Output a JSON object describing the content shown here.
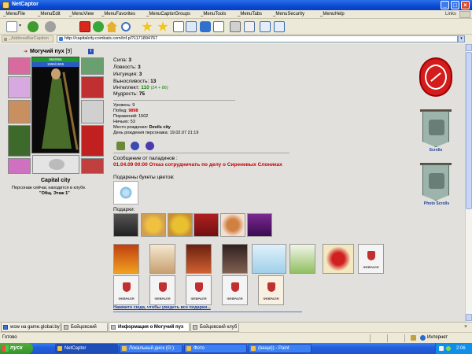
{
  "window": {
    "title": "NetCaptor"
  },
  "menu": {
    "items": [
      "_MenuFile",
      "_MenuEdit",
      "_MenuView",
      "_MenuFavorites",
      "_MenuCaptorGroups",
      "_MenuTools",
      "_MenuTabs",
      "_MenuSecurity",
      "_MenuHelp"
    ],
    "links": "Links"
  },
  "address": {
    "caption": "_AddressBarCaption",
    "url": "http://capitalcity.combats.com/inf.pl?1171894767"
  },
  "character": {
    "name": "Могучий пух",
    "level": "[9]",
    "info_badge": "i",
    "hp": "966/966",
    "mana": "1555/1555",
    "city": "Capital city",
    "location_text": "Персонаж сейчас находится в клубе.",
    "location_place": "\"Общ. Этаж 1\""
  },
  "stats": [
    {
      "label": "Сила:",
      "value": "3"
    },
    {
      "label": "Ловкость:",
      "value": "3"
    },
    {
      "label": "Интуиция:",
      "value": "3"
    },
    {
      "label": "Выносливость:",
      "value": "13"
    },
    {
      "label": "Интеллект:",
      "value": "110",
      "extra": "(24 + 86)"
    },
    {
      "label": "Мудрость:",
      "value": "75"
    }
  ],
  "record": [
    {
      "label": "Уровень:",
      "value": "9"
    },
    {
      "label": "Побед:",
      "value": "9898"
    },
    {
      "label": "Поражений:",
      "value": "1502"
    },
    {
      "label": "Ничьих:",
      "value": "53"
    },
    {
      "label": "Место рождения:",
      "value": "Devils city"
    },
    {
      "label": "День рождения персонажа:",
      "value": "19.02.07 21:19"
    }
  ],
  "paladins": {
    "heading": "Сообщение от паладинов :",
    "message": "01.04.09 00:00 Отказ сотрудничать по делу о Сиреневых Слониках"
  },
  "flowers_heading": "Подарены букеты цветов:",
  "gifts_heading": "Подарки:",
  "card_label": "ФЕВРАЛЯ",
  "more_link": "Нажмите сюда, чтобы увидеть все подарки...",
  "side": {
    "scrolls": "Scrolls",
    "photo_scrolls": "Photo Scrolls"
  },
  "tabs": [
    "wow на game.global.by",
    "Бойцовский клуб",
    "Информация о Могучий пух",
    "Бойцовский клуб"
  ],
  "status": {
    "text": "Готово",
    "zone": "Интернет"
  },
  "taskbar": {
    "start": "пуск",
    "tasks": [
      "NetCaptor",
      "Локальный диск (G:)",
      "Фото",
      "(ваще)) - Paint"
    ],
    "clock": "2:06"
  },
  "colors": {
    "accent_red": "#c00000",
    "link_blue": "#1a3f9a",
    "hp_green": "#1d9a2a",
    "mana_blue": "#2a5bc4"
  }
}
